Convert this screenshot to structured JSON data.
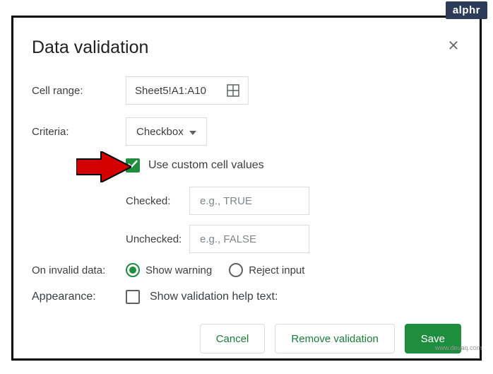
{
  "logo": "alphr",
  "watermark": "www.deuaq.com",
  "dialog": {
    "title": "Data validation",
    "cell_range": {
      "label": "Cell range:",
      "value": "Sheet5!A1:A10"
    },
    "criteria": {
      "label": "Criteria:",
      "dropdown_label": "Checkbox",
      "custom_values_label": "Use custom cell values",
      "checked": {
        "label": "Checked:",
        "placeholder": "e.g., TRUE"
      },
      "unchecked": {
        "label": "Unchecked:",
        "placeholder": "e.g., FALSE"
      }
    },
    "invalid_data": {
      "label": "On invalid data:",
      "options": {
        "warning": "Show warning",
        "reject": "Reject input"
      }
    },
    "appearance": {
      "label": "Appearance:",
      "help_text_label": "Show validation help text:"
    },
    "buttons": {
      "cancel": "Cancel",
      "remove": "Remove validation",
      "save": "Save"
    }
  }
}
